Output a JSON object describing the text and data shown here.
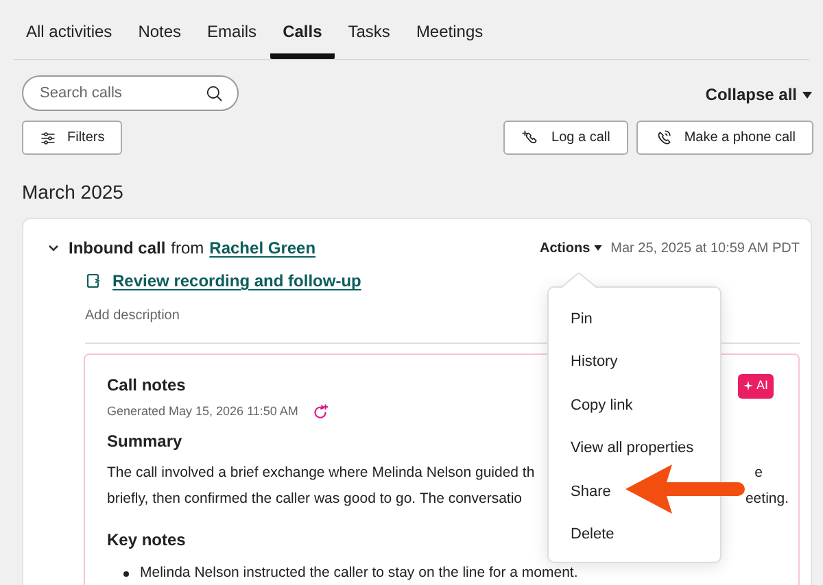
{
  "tabs": [
    {
      "label": "All activities",
      "selected": false
    },
    {
      "label": "Notes",
      "selected": false
    },
    {
      "label": "Emails",
      "selected": false
    },
    {
      "label": "Calls",
      "selected": true
    },
    {
      "label": "Tasks",
      "selected": false
    },
    {
      "label": "Meetings",
      "selected": false
    }
  ],
  "search": {
    "placeholder": "Search calls"
  },
  "collapse_button": "Collapse all",
  "filters_button": "Filters",
  "call_buttons": [
    {
      "kind": "log",
      "label": "Log a call"
    },
    {
      "kind": "phone",
      "label": "Make a phone call"
    }
  ],
  "month": "March 2025",
  "call": {
    "expanded": true,
    "type": "Inbound call",
    "from_word": "from",
    "contact": "Rachel Green",
    "actions": "Actions",
    "date": "Mar 25, 2025 at 10:59 AM PDT",
    "task_link": "Review recording and follow-up",
    "description_placeholder": "Add description",
    "notes": {
      "title": "Call notes",
      "badge": "AI",
      "generated": "Generated May 15, 2026 11:50 AM",
      "summary_heading": "Summary",
      "summary_lines": [
        {
          "left": "The call involved a brief exchange where Melinda Nelson guided th",
          "right": "e"
        },
        {
          "left": "briefly, then confirmed the caller was good to go. The conversatio",
          "right": "eeting."
        }
      ],
      "key_notes_heading": "Key notes",
      "key_notes": [
        "Melinda Nelson instructed the caller to stay on the line for a moment."
      ]
    }
  },
  "actions_menu": {
    "items": [
      "Pin",
      "History",
      "Copy link",
      "View all properties",
      "Share",
      "Delete"
    ]
  }
}
